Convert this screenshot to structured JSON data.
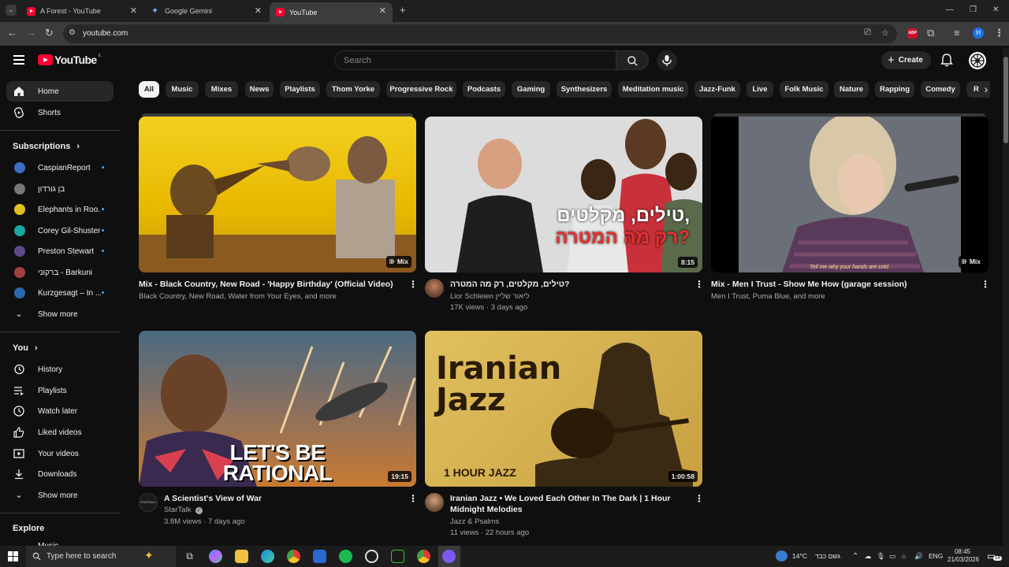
{
  "browser": {
    "tabs": [
      {
        "title": "A Forest - YouTube",
        "active": false
      },
      {
        "title": "Google Gemini",
        "active": false
      },
      {
        "title": "YouTube",
        "active": true
      }
    ],
    "new_tab": "+",
    "url": "youtube.com"
  },
  "header": {
    "logo_text": "YouTube",
    "logo_region": "IL",
    "search_placeholder": "Search",
    "create_label": "Create"
  },
  "sidebar": {
    "main": [
      {
        "label": "Home",
        "icon": "home-icon",
        "active": true
      },
      {
        "label": "Shorts",
        "icon": "shorts-icon",
        "active": false
      }
    ],
    "subscriptions_title": "Subscriptions",
    "subscriptions": [
      {
        "label": "CaspianReport",
        "color": "#3b6ec4",
        "new": true
      },
      {
        "label": "בן גורדון",
        "color": "#777777",
        "new": false
      },
      {
        "label": "Elephants in Roo...",
        "color": "#e0c020",
        "new": true
      },
      {
        "label": "Corey Gil-Shuster",
        "color": "#1aa8a0",
        "new": true
      },
      {
        "label": "Preston Stewart",
        "color": "#5a4a8a",
        "new": true
      },
      {
        "label": "ברקוני - Barkuni",
        "color": "#a04040",
        "new": false
      },
      {
        "label": "Kurzgesagt – In ...",
        "color": "#2a6ab0",
        "new": true
      }
    ],
    "show_more_1": "Show more",
    "you_title": "You",
    "you_items": [
      {
        "label": "History",
        "icon": "history-icon"
      },
      {
        "label": "Playlists",
        "icon": "playlists-icon"
      },
      {
        "label": "Watch later",
        "icon": "watch-later-icon"
      },
      {
        "label": "Liked videos",
        "icon": "thumbs-up-icon"
      },
      {
        "label": "Your videos",
        "icon": "your-videos-icon"
      },
      {
        "label": "Downloads",
        "icon": "download-icon"
      }
    ],
    "show_more_2": "Show more",
    "explore_title": "Explore",
    "explore_partial": "Music"
  },
  "chips": [
    "All",
    "Music",
    "Mixes",
    "News",
    "Playlists",
    "Thom Yorke",
    "Progressive Rock",
    "Podcasts",
    "Gaming",
    "Synthesizers",
    "Meditation music",
    "Jazz-Funk",
    "Live",
    "Folk Music",
    "Nature",
    "Rapping",
    "Comedy",
    "R"
  ],
  "videos": [
    {
      "title": "Mix - Black Country, New Road - 'Happy Birthday' (Official Video)",
      "meta1": "Black Country, New Road, Water from Your Eyes, and more",
      "meta2": "",
      "badge": "Mix",
      "thumb_colors": [
        "#e8b800",
        "#f2d020",
        "#6b4a20"
      ]
    },
    {
      "title": "טילים, מקלטים, רק מה המטרה?",
      "channel": "Lior Schleien ליאור שליין",
      "meta2": "17K views · 3 days ago",
      "badge": "8:15",
      "thumb_text": [
        "טילים, מקלטים,",
        "רק מה המטרה?"
      ],
      "thumb_colors": [
        "#d9d9d9",
        "#ffffff",
        "#e53030"
      ]
    },
    {
      "title": "Mix - Men I Trust - Show Me How (garage session)",
      "meta1": "Men I Trust, Puma Blue, and more",
      "meta2": "",
      "badge": "Mix",
      "thumb_caption": "Tell me why your hands are cold",
      "thumb_colors": [
        "#6a6f78",
        "#c9b89a",
        "#4a3a50"
      ]
    },
    {
      "title": "A Scientist's View of War",
      "channel": "StarTalk",
      "meta2": "3.8M views · 7 days ago",
      "badge": "19:15",
      "thumb_text": [
        "LET'S BE",
        "RATIONAL"
      ],
      "thumb_colors": [
        "#4a6a80",
        "#c87a30",
        "#1a1a1a"
      ]
    },
    {
      "title": "Iranian Jazz • We Loved Each Other In The Dark | 1 Hour Midnight Melodies",
      "channel": "Jazz & Psalms",
      "meta2": "11 views · 22 hours ago",
      "badge": "1:00:58",
      "thumb_text": [
        "Iranian",
        "Jazz",
        "1 HOUR JAZZ"
      ],
      "thumb_colors": [
        "#d4b04a",
        "#3a2a14",
        "#f0d070"
      ]
    }
  ],
  "taskbar": {
    "search_placeholder": "Type here to search",
    "weather": "14°C",
    "weather_desc": "גשם כבד",
    "lang": "ENG",
    "time": "08:45",
    "date": "21/03/2026",
    "notifications": "14"
  }
}
